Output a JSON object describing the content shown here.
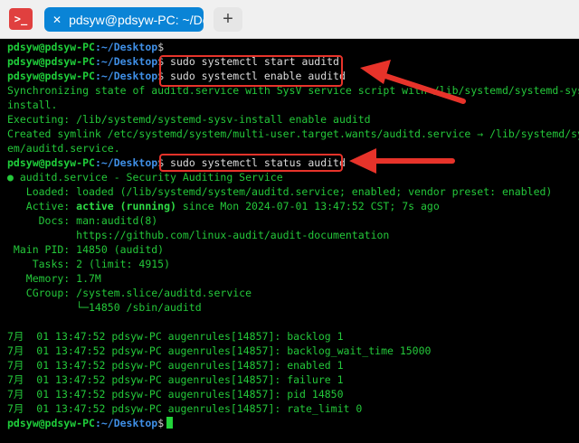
{
  "app": {
    "icon_glyph": ">_"
  },
  "tab": {
    "title": "pdsyw@pdsyw-PC: ~/Desktop",
    "close_glyph": "✕"
  },
  "new_tab": {
    "glyph": "+"
  },
  "prompt": {
    "user": "pdsyw@pdsyw-PC",
    "path": ":~/Desktop",
    "symbol": "$"
  },
  "lines": {
    "l0": {
      "cmd": ""
    },
    "l1": {
      "cmd": " sudo systemctl start auditd"
    },
    "l2": {
      "cmd": " sudo systemctl enable auditd"
    },
    "l3": "Synchronizing state of auditd.service with SysV service script with /lib/systemd/systemd-sysv-",
    "l4": "install.",
    "l5": "Executing: /lib/systemd/systemd-sysv-install enable auditd",
    "l6": "Created symlink /etc/systemd/system/multi-user.target.wants/auditd.service → /lib/systemd/syst",
    "l7": "em/auditd.service.",
    "l8": {
      "cmd": " sudo systemctl status auditd"
    },
    "l9": "● auditd.service - Security Auditing Service",
    "l10": "   Loaded: loaded (/lib/systemd/system/auditd.service; enabled; vendor preset: enabled)",
    "l11": {
      "pre": "   Active: ",
      "active": "active (running)",
      "post": " since Mon 2024-07-01 13:47:52 CST; 7s ago"
    },
    "l12": "     Docs: man:auditd(8)",
    "l13": "           https://github.com/linux-audit/audit-documentation",
    "l14": " Main PID: 14850 (auditd)",
    "l15": "    Tasks: 2 (limit: 4915)",
    "l16": "   Memory: 1.7M",
    "l17": "   CGroup: /system.slice/auditd.service",
    "l18": "           └─14850 /sbin/auditd",
    "l19": "",
    "l20": "7月  01 13:47:52 pdsyw-PC augenrules[14857]: backlog 1",
    "l21": "7月  01 13:47:52 pdsyw-PC augenrules[14857]: backlog_wait_time 15000",
    "l22": "7月  01 13:47:52 pdsyw-PC augenrules[14857]: enabled 1",
    "l23": "7月  01 13:47:52 pdsyw-PC augenrules[14857]: failure 1",
    "l24": "7月  01 13:47:52 pdsyw-PC augenrules[14857]: pid 14850",
    "l25": "7月  01 13:47:52 pdsyw-PC augenrules[14857]: rate_limit 0"
  },
  "colors": {
    "annotation": "#e7332a",
    "prompt_user": "#1fce3a",
    "prompt_path": "#3f8fe6",
    "output_green": "#24c83a",
    "tab_active": "#0a84d6"
  }
}
